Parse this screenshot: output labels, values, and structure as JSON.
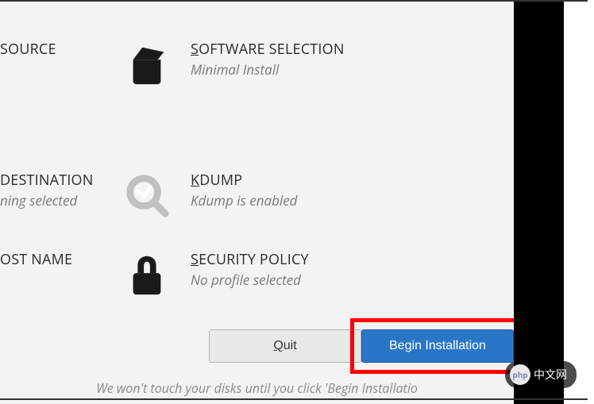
{
  "items": {
    "source": {
      "title": "SOURCE"
    },
    "software": {
      "title": "SOFTWARE SELECTION",
      "sub": "Minimal Install"
    },
    "destination": {
      "title": "DESTINATION",
      "sub": "ning selected"
    },
    "kdump": {
      "title": "KDUMP",
      "sub": "Kdump is enabled"
    },
    "hostname": {
      "title": "OST NAME"
    },
    "security": {
      "title": "SECURITY POLICY",
      "sub": "No profile selected"
    }
  },
  "buttons": {
    "quit_prefix": "Q",
    "quit_rest": "uit",
    "begin": "Begin Installation"
  },
  "hint": "We won't touch your disks until you click 'Begin Installatio",
  "watermark": {
    "logo": "php",
    "text": "中文网"
  }
}
